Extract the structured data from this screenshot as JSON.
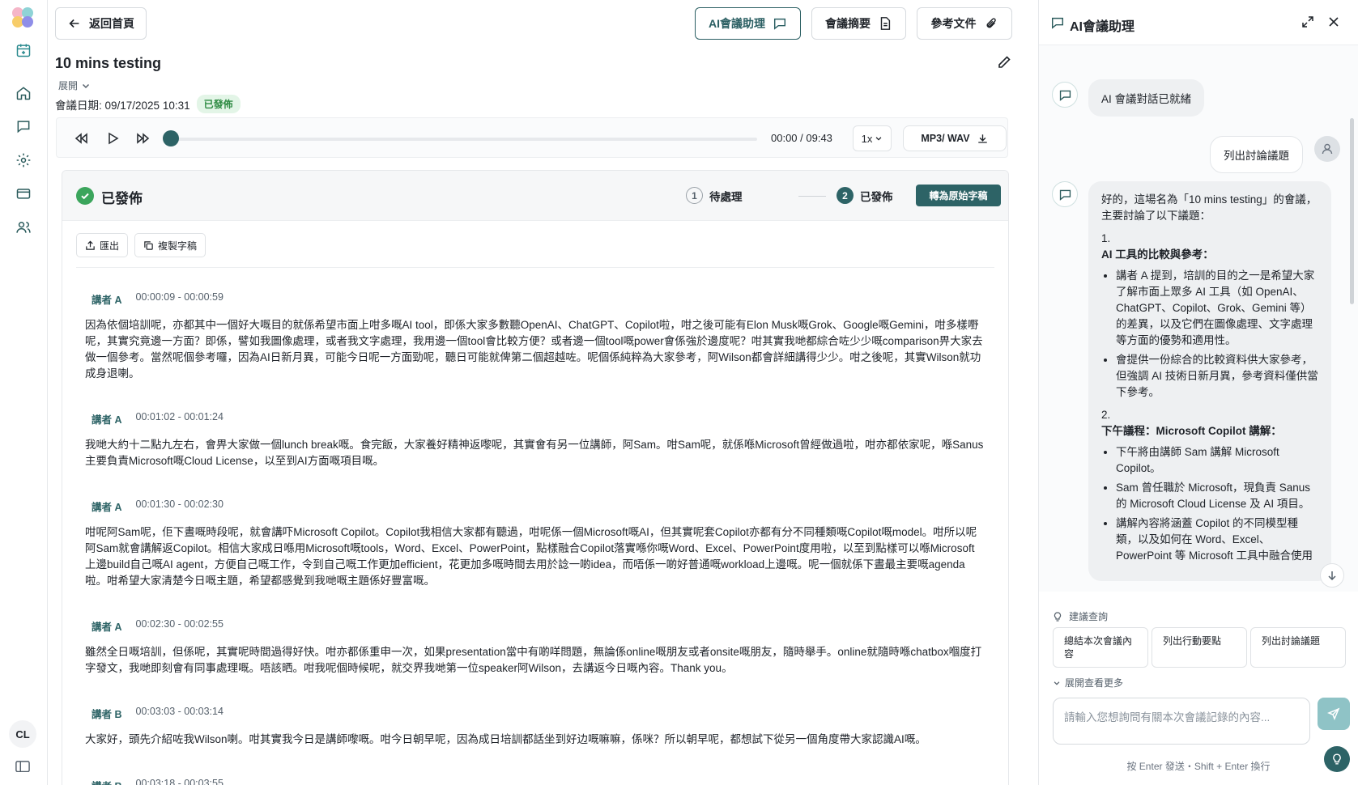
{
  "header": {
    "back_label": "返回首頁",
    "ai_assistant_label": "AI會議助理",
    "summary_label": "會議摘要",
    "reference_label": "參考文件"
  },
  "meeting": {
    "title": "10 mins testing",
    "expand_label": "展開",
    "date_label": "會議日期: 09/17/2025 10:31",
    "status_badge": "已發佈"
  },
  "player": {
    "time": "00:00 / 09:43",
    "speed": "1x",
    "download_label": "MP3/ WAV",
    "progress": 0.0
  },
  "transcript": {
    "title": "已發佈",
    "steps": [
      {
        "num": "1",
        "label": "待處理"
      },
      {
        "num": "2",
        "label": "已發佈"
      }
    ],
    "convert_label": "轉為原始字稿",
    "export_label": "匯出",
    "copy_label": "複製字稿",
    "segments": [
      {
        "speaker": "講者 A",
        "time": "00:00:09 - 00:00:59",
        "text": "因為依個培訓呢，亦都其中一個好大嘅目的就係希望市面上咁多嘅AI tool，即係大家多數聽OpenAI、ChatGPT、Copilot啦，咁之後可能有Elon Musk嘅Grok、Google嘅Gemini，咁多樣嘢呢，其實究竟邊一方面？即係，譬如我圖像處理，或者我文字處理，我用邊一個tool會比較方便？或者邊一個tool嘅power會係強於邊度呢？咁其實我哋都綜合咗少少嘅comparison畀大家去做一個參考。當然呢個參考囉，因為AI日新月異，可能今日呢一方面勁呢，聽日可能就俾第二個超越咗。呢個係純粹為大家參考，阿Wilson都會詳細講得少少。咁之後呢，其實Wilson就功成身退喇。"
      },
      {
        "speaker": "講者 A",
        "time": "00:01:02 - 00:01:24",
        "text": "我哋大約十二點九左右，會畀大家做一個lunch break嘅。食完飯，大家養好精神返嚟呢，其實會有另一位講師，阿Sam。咁Sam呢，就係喺Microsoft曾經做過啦，咁亦都依家呢，喺Sanus主要負責Microsoft嘅Cloud License，以至到AI方面嘅項目嘅。"
      },
      {
        "speaker": "講者 A",
        "time": "00:01:30 - 00:02:30",
        "text": "咁呢阿Sam呢，佢下晝嘅時段呢，就會講吓Microsoft Copilot。Copilot我相信大家都有聽過，咁呢係一個Microsoft嘅AI，但其實呢套Copilot亦都有分不同種類嘅Copilot嘅model。咁所以呢阿Sam就會講解返Copilot。相信大家成日喺用Microsoft嘅tools，Word、Excel、PowerPoint，點樣融合Copilot落實喺你嘅Word、Excel、PowerPoint度用啦，以至到點樣可以喺Microsoft上邊build自己嘅AI agent，方便自己嘅工作，令到自己嘅工作更加efficient，花更加多嘅時間去用於諗一啲idea，而唔係一啲好普通嘅workload上邊嘅。呢一個就係下晝最主要嘅agenda啦。咁希望大家清楚今日嘅主題，希望都感覺到我哋嘅主題係好豐富嘅。"
      },
      {
        "speaker": "講者 A",
        "time": "00:02:30 - 00:02:55",
        "text": "雖然全日嘅培訓，但係呢，其實呢時間過得好快。咁亦都係重申一次，如果presentation當中有啲咩問題，無論係online嘅朋友或者onsite嘅朋友，隨時舉手。online就隨時喺chatbox嗰度打字發文，我哋即刻會有同事處理嘅。唔該晒。咁我呢個時候呢，就交界我哋第一位speaker阿Wilson，去講返今日嘅內容。Thank you。"
      },
      {
        "speaker": "講者 B",
        "time": "00:03:03 - 00:03:14",
        "text": "大家好，頭先介紹咗我Wilson喇。咁其實我今日是講師嚟嘅。咁今日朝早呢，因為成日培訓都話坐到好边嘅嘛嘛，係咪？所以朝早呢，都想試下從另一個角度帶大家認識AI嘅。"
      },
      {
        "speaker": "講者 B",
        "time": "00:03:18 - 00:03:55",
        "text": ""
      }
    ]
  },
  "assistant": {
    "title": "AI會議助理",
    "ready_msg": "AI 會議對話已就緒",
    "user_msg": "列出討論議題",
    "answer": {
      "intro": "好的，這場名為「10 mins testing」的會議，主要討論了以下議題：",
      "sections": [
        {
          "num": "1.",
          "heading": "AI 工具的比較與參考",
          "bullets": [
            "講者 A 提到，培訓的目的之一是希望大家了解市面上眾多 AI 工具（如 OpenAI、ChatGPT、Copilot、Grok、Gemini 等）的差異，以及它們在圖像處理、文字處理等方面的優勢和適用性。",
            "會提供一份綜合的比較資料供大家參考，但強調 AI 技術日新月異，參考資料僅供當下參考。"
          ]
        },
        {
          "num": "2.",
          "heading": "下午議程：Microsoft Copilot 講解",
          "bullets": [
            "下午將由講師 Sam 講解 Microsoft Copilot。",
            "Sam 曾任職於 Microsoft，現負責 Sanus 的 Microsoft Cloud License 及 AI 項目。",
            "講解內容將涵蓋 Copilot 的不同模型種類，以及如何在 Word、Excel、PowerPoint 等 Microsoft 工具中融合使用"
          ]
        }
      ]
    },
    "suggest_label": "建議查詢",
    "suggestions": [
      "總結本次會議內容",
      "列出行動要點",
      "列出討論議題"
    ],
    "more_label": "展開查看更多",
    "input_placeholder": "請輸入您想詢問有關本次會議記錄的內容...",
    "hint": "按 Enter 發送・Shift + Enter 換行"
  },
  "user": {
    "initials": "CL"
  },
  "colors": {
    "accent": "#2d6366",
    "published": "#3ba55c",
    "badge_bg": "#e3f5e7"
  }
}
